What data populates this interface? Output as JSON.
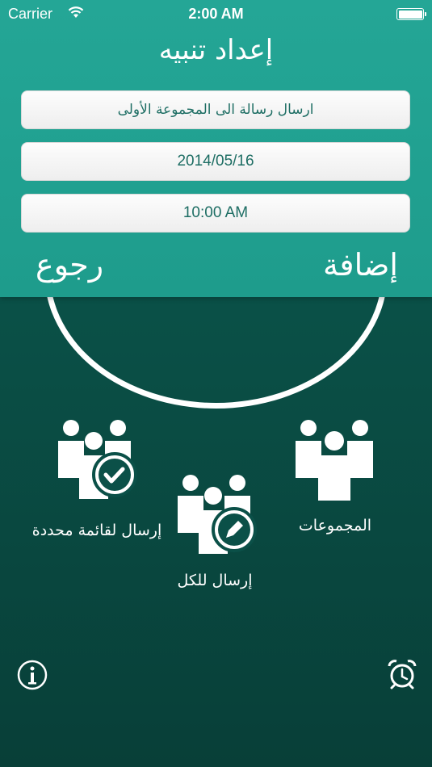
{
  "status_bar": {
    "carrier": "Carrier",
    "time": "2:00 AM"
  },
  "header": {
    "title": "إعداد تنبيه"
  },
  "form": {
    "message": "ارسال رسالة الى المجموعة الأولى",
    "date": "2014/05/16",
    "time": "10:00 AM"
  },
  "nav": {
    "back_label": "رجوع",
    "add_label": "إضافة"
  },
  "actions": {
    "groups_label": "المجموعات",
    "send_list_label": "إرسال لقائمة محددة",
    "send_all_label": "إرسال للكل"
  },
  "icons": {
    "wifi": "wifi-icon",
    "battery": "battery-icon",
    "groups": "groups-icon",
    "send_list": "group-check-icon",
    "send_all": "group-edit-icon",
    "info": "info-icon",
    "alarm": "alarm-clock-icon"
  },
  "colors": {
    "header": "#21a293",
    "background": "#0a4d45",
    "field_text": "#1e6e64",
    "white": "#ffffff"
  }
}
